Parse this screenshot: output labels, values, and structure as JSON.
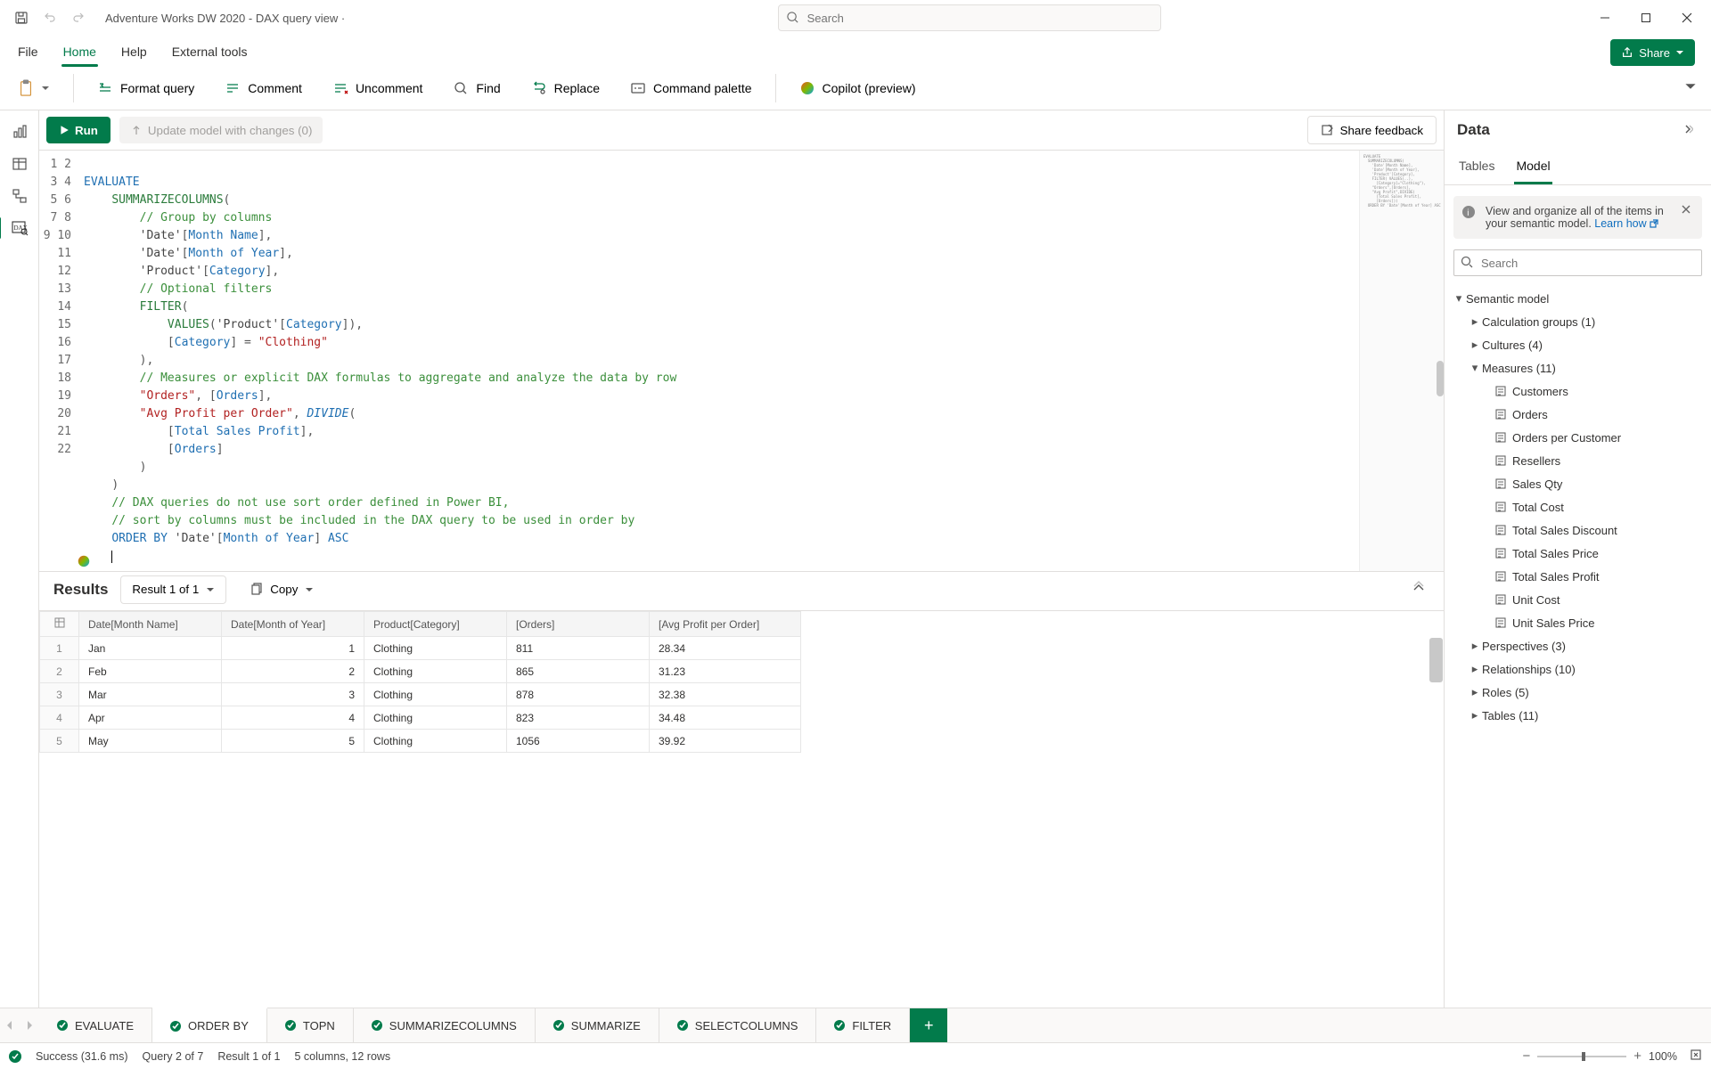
{
  "titlebar": {
    "app_title": "Adventure Works DW 2020 - DAX query view ·",
    "search_placeholder": "Search"
  },
  "menubar": {
    "items": [
      "File",
      "Home",
      "Help",
      "External tools"
    ],
    "active": 1,
    "share_label": "Share"
  },
  "ribbon": {
    "paste": "",
    "format": "Format query",
    "comment": "Comment",
    "uncomment": "Uncomment",
    "find": "Find",
    "replace": "Replace",
    "cmdpal": "Command palette",
    "copilot": "Copilot (preview)"
  },
  "qtoolbar": {
    "run": "Run",
    "update": "Update model with changes (0)",
    "feedback": "Share feedback"
  },
  "editor": {
    "lines": [
      1,
      2,
      3,
      4,
      5,
      6,
      7,
      8,
      9,
      10,
      11,
      12,
      13,
      14,
      15,
      16,
      17,
      18,
      19,
      20,
      21,
      22
    ]
  },
  "results": {
    "title": "Results",
    "selector": "Result 1 of 1",
    "copy": "Copy",
    "columns": [
      "Date[Month Name]",
      "Date[Month of Year]",
      "Product[Category]",
      "[Orders]",
      "[Avg Profit per Order]"
    ],
    "rows": [
      {
        "n": 1,
        "c": [
          "Jan",
          "1",
          "Clothing",
          "811",
          "28.34"
        ]
      },
      {
        "n": 2,
        "c": [
          "Feb",
          "2",
          "Clothing",
          "865",
          "31.23"
        ]
      },
      {
        "n": 3,
        "c": [
          "Mar",
          "3",
          "Clothing",
          "878",
          "32.38"
        ]
      },
      {
        "n": 4,
        "c": [
          "Apr",
          "4",
          "Clothing",
          "823",
          "34.48"
        ]
      },
      {
        "n": 5,
        "c": [
          "May",
          "5",
          "Clothing",
          "1056",
          "39.92"
        ]
      }
    ]
  },
  "queryTabs": {
    "tabs": [
      "EVALUATE",
      "ORDER BY",
      "TOPN",
      "SUMMARIZECOLUMNS",
      "SUMMARIZE",
      "SELECTCOLUMNS",
      "FILTER"
    ],
    "active": 1
  },
  "status": {
    "success": "Success (31.6 ms)",
    "query": "Query 2 of 7",
    "result": "Result 1 of 1",
    "shape": "5 columns, 12 rows",
    "zoom": "100%"
  },
  "datapane": {
    "title": "Data",
    "tabs": [
      "Tables",
      "Model"
    ],
    "active": 1,
    "info_text": "View and organize all of the items in your semantic model. ",
    "info_link": "Learn how",
    "search_placeholder": "Search",
    "root": "Semantic model",
    "nodes_l1": [
      {
        "label": "Calculation groups (1)",
        "expanded": false
      },
      {
        "label": "Cultures (4)",
        "expanded": false
      },
      {
        "label": "Measures (11)",
        "expanded": true
      },
      {
        "label": "Perspectives (3)",
        "expanded": false
      },
      {
        "label": "Relationships (10)",
        "expanded": false
      },
      {
        "label": "Roles (5)",
        "expanded": false
      },
      {
        "label": "Tables (11)",
        "expanded": false
      }
    ],
    "measures": [
      "Customers",
      "Orders",
      "Orders per Customer",
      "Resellers",
      "Sales Qty",
      "Total Cost",
      "Total Sales Discount",
      "Total Sales Price",
      "Total Sales Profit",
      "Unit Cost",
      "Unit Sales Price"
    ]
  }
}
